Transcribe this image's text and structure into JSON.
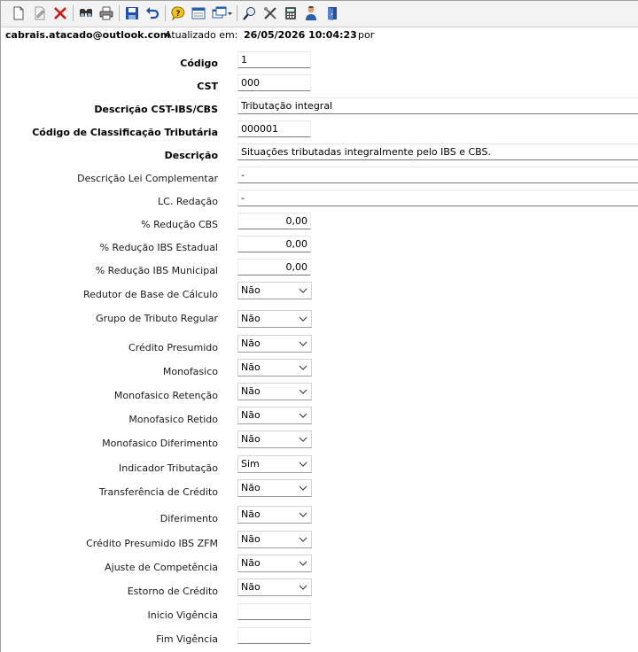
{
  "toolbar": {
    "buttons": [
      "new-icon",
      "edit-icon",
      "delete-icon",
      "find-icon",
      "print-icon",
      "save-icon",
      "undo-icon",
      "help-icon",
      "form-icon",
      "window-menu-icon",
      "search-icon",
      "tools-icon",
      "calculator-icon",
      "user-icon",
      "exit-icon"
    ]
  },
  "info": {
    "user": "cabrais.atacado@outlook.com",
    "updated_label": "Atualizado em:",
    "updated_value": "26/05/2026 10:04:23",
    "by_label": "por"
  },
  "form": {
    "codigo": {
      "label": "Código",
      "value": "1"
    },
    "cst": {
      "label": "CST",
      "value": "000"
    },
    "descricao_cst": {
      "label": "Descrição CST-IBS/CBS",
      "value": "Tributação integral"
    },
    "cod_class": {
      "label": "Código de Classificação Tributária",
      "value": "000001"
    },
    "descricao": {
      "label": "Descrição",
      "value": "Situações tributadas integralmente pelo IBS e CBS."
    },
    "desc_lei": {
      "label": "Descrição Lei Complementar",
      "value": "-"
    },
    "lc_redacao": {
      "label": "LC. Redação",
      "value": "-"
    },
    "red_cbs": {
      "label": "% Redução CBS",
      "value": "0,00"
    },
    "red_ibs_est": {
      "label": "% Redução IBS Estadual",
      "value": "0,00"
    },
    "red_ibs_mun": {
      "label": "% Redução IBS Municipal",
      "value": "0,00"
    },
    "redutor_base": {
      "label": "Redutor de Base de Cálculo",
      "value": "Não"
    },
    "grupo_tributo": {
      "label": "Grupo de Tributo Regular",
      "value": "Não"
    },
    "credito_presumido": {
      "label": "Crédito Presumido",
      "value": "Não"
    },
    "monofasico": {
      "label": "Monofasico",
      "value": "Não"
    },
    "mono_retencao": {
      "label": "Monofasico Retenção",
      "value": "Não"
    },
    "mono_retido": {
      "label": "Monofasico Retido",
      "value": "Não"
    },
    "mono_diferimento": {
      "label": "Monofasico Diferimento",
      "value": "Não"
    },
    "ind_tributacao": {
      "label": "Indicador Tributação",
      "value": "Sim"
    },
    "transf_credito": {
      "label": "Transferência de Crédito",
      "value": "Não"
    },
    "diferimento": {
      "label": "Diferimento",
      "value": "Não"
    },
    "cred_pres_zfm": {
      "label": "Crédito Presumido IBS ZFM",
      "value": "Não"
    },
    "ajuste_comp": {
      "label": "Ajuste de Competência",
      "value": "Não"
    },
    "estorno_credito": {
      "label": "Estorno de Crédito",
      "value": "Não"
    },
    "inicio_vigencia": {
      "label": "Inicio Vigência",
      "value": ""
    },
    "fim_vigencia": {
      "label": "Fim Vigência",
      "value": ""
    }
  }
}
